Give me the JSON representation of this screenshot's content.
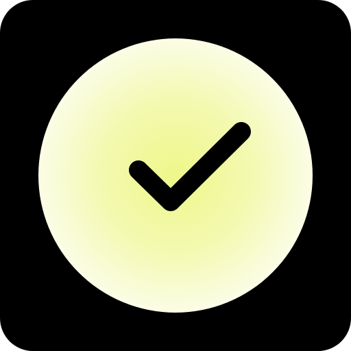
{
  "icon": {
    "name": "check-circle-icon",
    "background_color": "#000000",
    "circle_center_color": "#eef78a",
    "circle_edge_color": "#fbfde6",
    "checkmark_color": "#000000"
  }
}
